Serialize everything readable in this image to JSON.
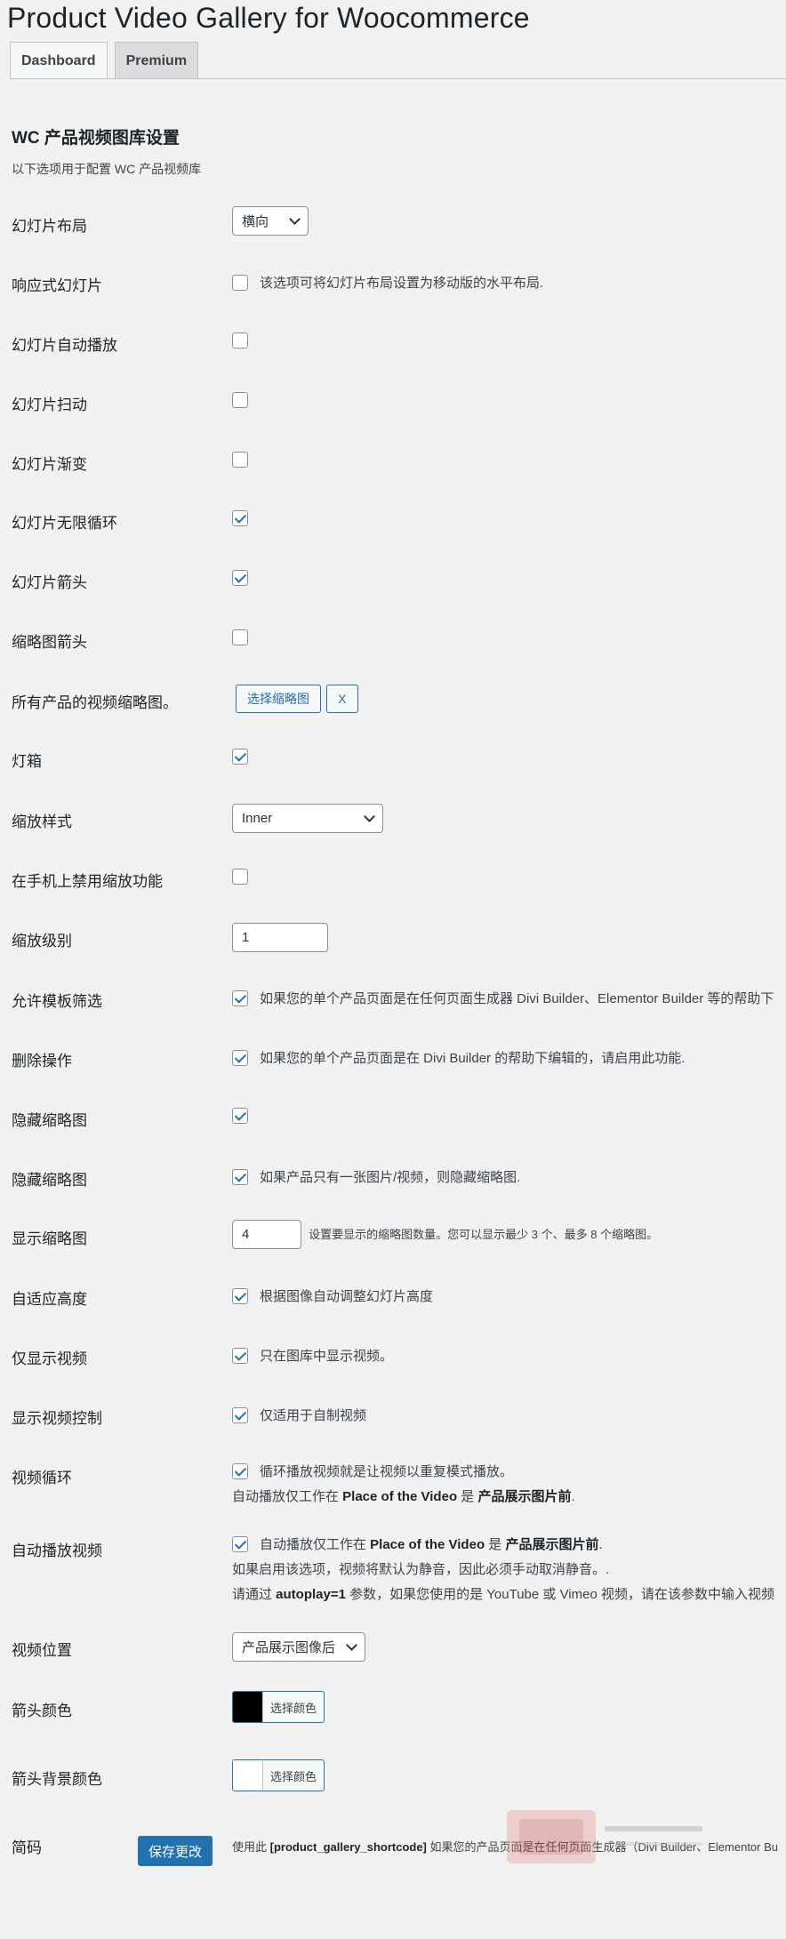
{
  "page_title": "Product Video Gallery for Woocommerce",
  "tabs": [
    {
      "label": "Dashboard"
    },
    {
      "label": "Premium"
    }
  ],
  "section": {
    "title": "WC 产品视频图库设置",
    "desc": "以下选项用于配置 WC 产品视频库"
  },
  "fields": {
    "slider_layout": {
      "label": "幻灯片布局",
      "value": "横向"
    },
    "responsive_slider": {
      "label": "响应式幻灯片",
      "checked": false,
      "desc": "该选项可将幻灯片布局设置为移动版的水平布局."
    },
    "slider_autoplay": {
      "label": "幻灯片自动播放",
      "checked": false
    },
    "slider_swipe": {
      "label": "幻灯片扫动",
      "checked": false
    },
    "slider_fade": {
      "label": "幻灯片渐变",
      "checked": false
    },
    "slider_infinite": {
      "label": "幻灯片无限循环",
      "checked": true
    },
    "slider_arrows": {
      "label": "幻灯片箭头",
      "checked": true
    },
    "thumb_arrows": {
      "label": "缩略图箭头",
      "checked": false
    },
    "video_thumbnail": {
      "label": "所有产品的视频缩略图。",
      "choose_label": "选择缩略图",
      "clear_label": "X"
    },
    "lightbox": {
      "label": "灯箱",
      "checked": true
    },
    "zoom_style": {
      "label": "缩放样式",
      "value": "Inner"
    },
    "disable_zoom_mobile": {
      "label": "在手机上禁用缩放功能",
      "checked": false
    },
    "zoom_level": {
      "label": "缩放级别",
      "value": "1"
    },
    "template_filter": {
      "label": "允许模板筛选",
      "checked": true,
      "desc": "如果您的单个产品页面是在任何页面生成器 Divi Builder、Elementor Builder 等的帮助下"
    },
    "remove_action": {
      "label": "删除操作",
      "checked": true,
      "desc": "如果您的单个产品页面是在 Divi Builder 的帮助下编辑的，请启用此功能."
    },
    "hide_thumbs": {
      "label": "隐藏缩略图",
      "checked": true
    },
    "hide_thumbs_single": {
      "label": "隐藏缩略图",
      "checked": true,
      "desc": "如果产品只有一张图片/视频，则隐藏缩略图."
    },
    "show_thumbs": {
      "label": "显示缩略图",
      "value": "4",
      "desc": "设置要显示的缩略图数量。您可以显示最少 3 个、最多 8 个缩略图。"
    },
    "adaptive_height": {
      "label": "自适应高度",
      "checked": true,
      "desc": "根据图像自动调整幻灯片高度"
    },
    "video_only": {
      "label": "仅显示视频",
      "checked": true,
      "desc": "只在图库中显示视频。"
    },
    "video_controls": {
      "label": "显示视频控制",
      "checked": true,
      "desc": "仅适用于自制视频"
    },
    "video_loop": {
      "label": "视频循环",
      "checked": true,
      "desc": "循环播放视频就是让视频以重复模式播放。",
      "line2_prefix": "自动播放仅工作在 ",
      "line2_bold1": "Place of the Video",
      "line2_mid": " 是 ",
      "line2_bold2": "产品展示图片前",
      "line2_suffix": "."
    },
    "video_autoplay": {
      "label": "自动播放视频",
      "checked": true,
      "desc_prefix": "自动播放仅工作在 ",
      "desc_bold1": "Place of the Video",
      "desc_mid": " 是 ",
      "desc_bold2": "产品展示图片前",
      "desc_suffix": ".",
      "line2": "如果启用该选项，视频将默认为静音，因此必须手动取消静音。.",
      "line3_prefix": "请通过 ",
      "line3_bold": "autoplay=1",
      "line3_suffix": " 参数，如果您使用的是 YouTube 或 Vimeo 视频，请在该参数中输入视频"
    },
    "video_position": {
      "label": "视频位置",
      "value": "产品展示图像后"
    },
    "arrow_color": {
      "label": "箭头颜色",
      "button": "选择颜色",
      "color": "#000000"
    },
    "arrow_bg_color": {
      "label": "箭头背景颜色",
      "button": "选择颜色",
      "color": "#ffffff"
    },
    "shortcode": {
      "label": "简码",
      "prefix": "使用此 ",
      "bold": "[product_gallery_shortcode]",
      "suffix": " 如果您的产品页面是在任何页面生成器（Divi Builder、Elementor Bu"
    }
  },
  "save_button": "保存更改",
  "colors": {
    "accent": "#2271b1",
    "background": "#f1f1f1"
  }
}
